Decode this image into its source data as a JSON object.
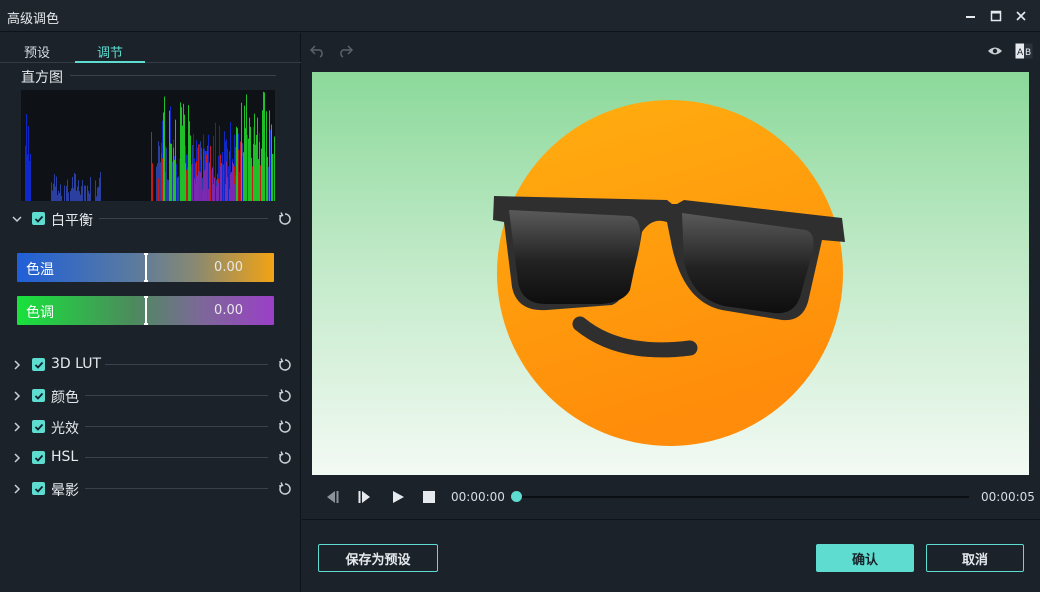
{
  "window": {
    "title": "高级调色"
  },
  "tabs": [
    {
      "label": "预设"
    },
    {
      "label": "调节"
    }
  ],
  "histogram": {
    "label": "直方图"
  },
  "sections": {
    "white_balance": {
      "label": "白平衡",
      "checked": true,
      "expanded": true
    },
    "lut": {
      "label": "3D LUT",
      "checked": true
    },
    "color": {
      "label": "颜色",
      "checked": true
    },
    "light": {
      "label": "光效",
      "checked": true
    },
    "hsl": {
      "label": "HSL",
      "checked": true
    },
    "vignette": {
      "label": "晕影",
      "checked": true
    }
  },
  "sliders": {
    "temperature": {
      "label": "色温",
      "value": "0.00"
    },
    "tint": {
      "label": "色调",
      "value": "0.00"
    }
  },
  "toolbar": {
    "undo": "undo-icon",
    "redo": "redo-icon",
    "preview": "eye-icon",
    "compare": "ab-compare-icon"
  },
  "playback": {
    "current_time": "00:00:00",
    "total_time": "00:00:05",
    "progress": 0
  },
  "buttons": {
    "save_preset": "保存为预设",
    "confirm": "确认",
    "cancel": "取消"
  },
  "colors": {
    "accent": "#5edcd0",
    "panel": "#1b2229"
  }
}
